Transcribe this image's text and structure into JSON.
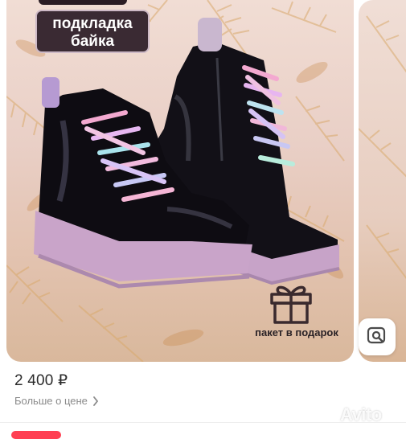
{
  "listing": {
    "badge_line1": "подкладка",
    "badge_line2": "байка",
    "gift_label": "пакет в подарок",
    "price": "2 400 ₽",
    "price_more_label": "Больше о цене",
    "watermark": "Avito"
  },
  "colors": {
    "badge_bg": "#3a2a33",
    "boot_black": "#111015",
    "sole_lilac": "#c8a6c9",
    "action_red": "#ff4053",
    "watermark_white": "#ffffff"
  },
  "icons": {
    "gift": "gift-icon",
    "visual_search": "image-search-icon",
    "chevron": "chevron-right-icon",
    "avito_logo": "avito-logo-icon"
  }
}
